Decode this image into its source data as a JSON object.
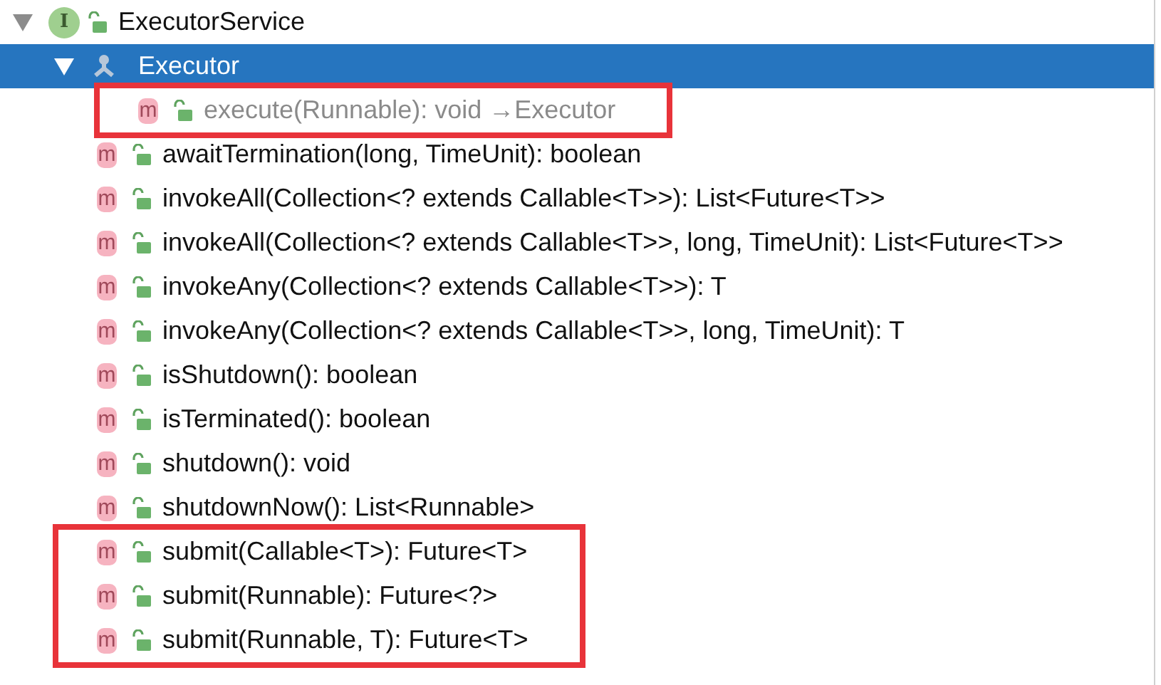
{
  "tree": [
    {
      "kind": "interface",
      "badge": "I",
      "label": "ExecutorService",
      "expanded": true,
      "selected": false,
      "children": [
        {
          "kind": "parent",
          "label": "Executor",
          "expanded": true,
          "selected": true,
          "children": [
            {
              "kind": "method",
              "badge": "m",
              "label": "execute(Runnable): void →Executor",
              "selected": false,
              "inherited": true,
              "boxed": true
            }
          ]
        },
        {
          "kind": "method",
          "badge": "m",
          "label": "awaitTermination(long, TimeUnit): boolean",
          "selected": false,
          "inherited": false,
          "boxed": false
        },
        {
          "kind": "method",
          "badge": "m",
          "label": "invokeAll(Collection<? extends Callable<T>>): List<Future<T>>",
          "selected": false,
          "inherited": false,
          "boxed": false
        },
        {
          "kind": "method",
          "badge": "m",
          "label": "invokeAll(Collection<? extends Callable<T>>, long, TimeUnit): List<Future<T>>",
          "selected": false,
          "inherited": false,
          "boxed": false
        },
        {
          "kind": "method",
          "badge": "m",
          "label": "invokeAny(Collection<? extends Callable<T>>): T",
          "selected": false,
          "inherited": false,
          "boxed": false
        },
        {
          "kind": "method",
          "badge": "m",
          "label": "invokeAny(Collection<? extends Callable<T>>, long, TimeUnit): T",
          "selected": false,
          "inherited": false,
          "boxed": false
        },
        {
          "kind": "method",
          "badge": "m",
          "label": "isShutdown(): boolean",
          "selected": false,
          "inherited": false,
          "boxed": false
        },
        {
          "kind": "method",
          "badge": "m",
          "label": "isTerminated(): boolean",
          "selected": false,
          "inherited": false,
          "boxed": false
        },
        {
          "kind": "method",
          "badge": "m",
          "label": "shutdown(): void",
          "selected": false,
          "inherited": false,
          "boxed": false
        },
        {
          "kind": "method",
          "badge": "m",
          "label": "shutdownNow(): List<Runnable>",
          "selected": false,
          "inherited": false,
          "boxed": false
        },
        {
          "kind": "method",
          "badge": "m",
          "label": "submit(Callable<T>): Future<T>",
          "selected": false,
          "inherited": false,
          "boxed": true
        },
        {
          "kind": "method",
          "badge": "m",
          "label": "submit(Runnable): Future<?>",
          "selected": false,
          "inherited": false,
          "boxed": true
        },
        {
          "kind": "method",
          "badge": "m",
          "label": "submit(Runnable, T): Future<T>",
          "selected": false,
          "inherited": false,
          "boxed": true
        }
      ]
    }
  ]
}
